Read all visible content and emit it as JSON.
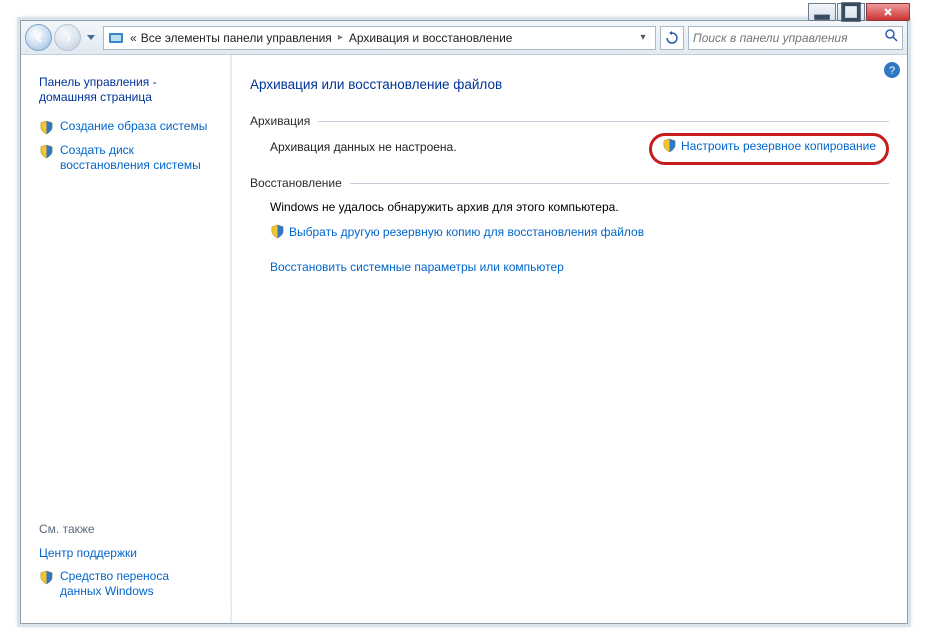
{
  "window": {
    "minimize": "_",
    "maximize": "▫",
    "close": "×"
  },
  "toolbar": {
    "breadcrumb_prefix": "«",
    "breadcrumb1": "Все элементы панели управления",
    "breadcrumb2": "Архивация и восстановление",
    "search_placeholder": "Поиск в панели управления"
  },
  "sidebar": {
    "home": "Панель управления - домашняя страница",
    "links": [
      "Создание образа системы",
      "Создать диск восстановления системы"
    ],
    "see_also_label": "См. также",
    "see_also": [
      "Центр поддержки",
      "Средство переноса данных Windows"
    ]
  },
  "main": {
    "title": "Архивация или восстановление файлов",
    "section_backup": "Архивация",
    "backup_status": "Архивация данных не настроена.",
    "backup_action": "Настроить резервное копирование",
    "section_restore": "Восстановление",
    "restore_status": "Windows не удалось обнаружить архив для этого компьютера.",
    "restore_link": "Выбрать другую резервную копию для восстановления файлов",
    "sys_restore_link": "Восстановить системные параметры или компьютер"
  }
}
